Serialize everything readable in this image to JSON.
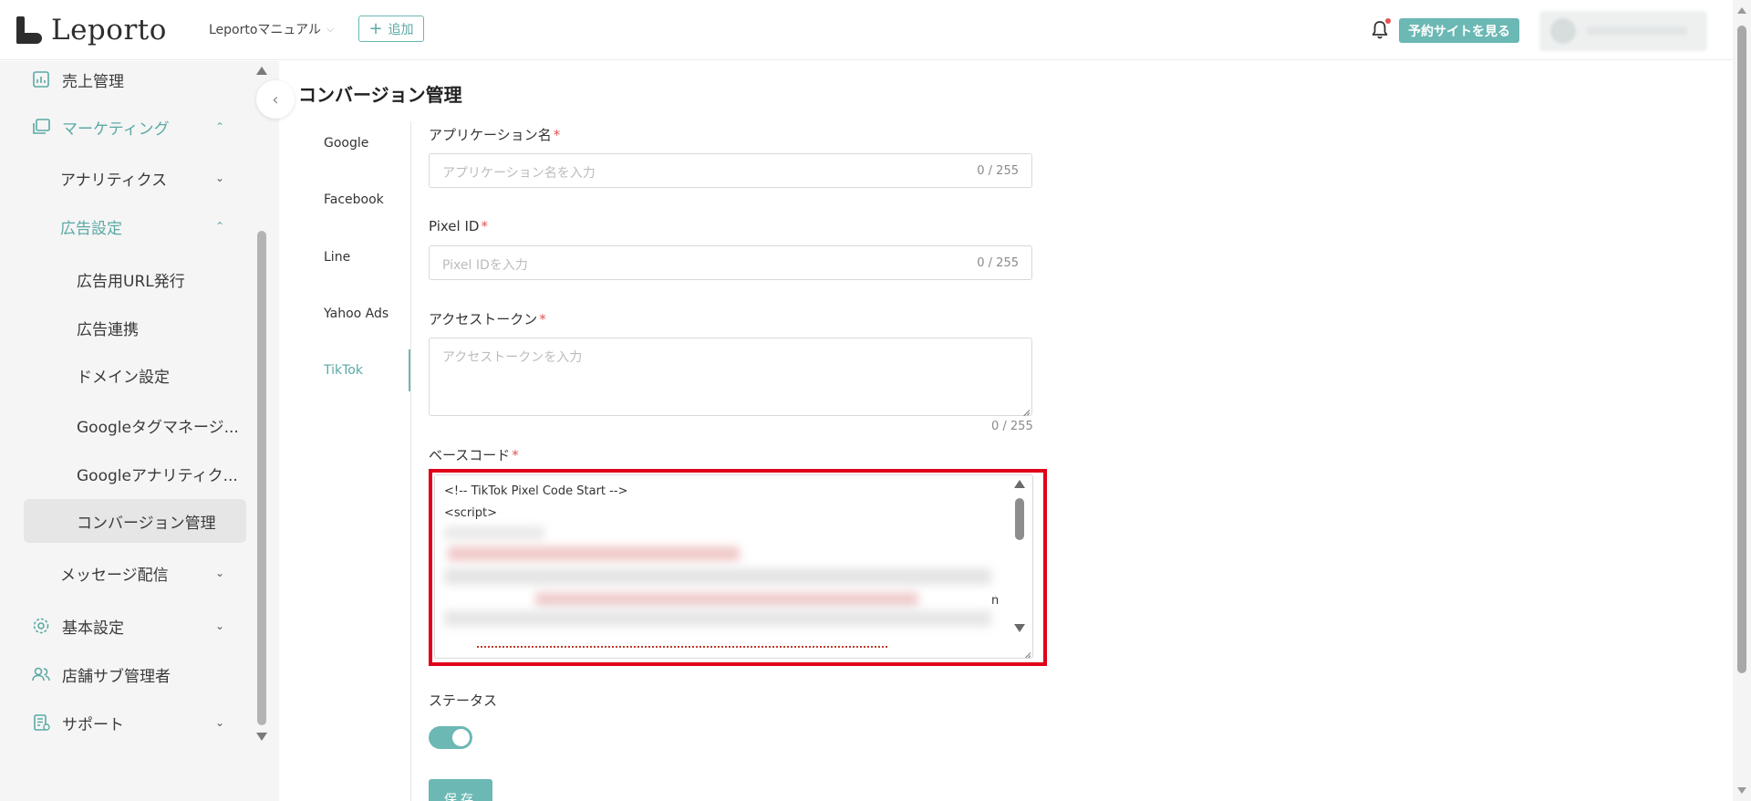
{
  "header": {
    "logo_text": "Leporto",
    "site_select": "Leportoマニュアル",
    "add_label": "追加",
    "view_site_label": "予約サイトを見る"
  },
  "sidebar": {
    "items": [
      {
        "label": "売上管理"
      },
      {
        "label": "マーケティング"
      },
      {
        "label": "アナリティクス"
      },
      {
        "label": "広告設定"
      },
      {
        "label": "広告用URL発行"
      },
      {
        "label": "広告連携"
      },
      {
        "label": "ドメイン設定"
      },
      {
        "label": "Googleタグマネージ..."
      },
      {
        "label": "Googleアナリティク..."
      },
      {
        "label": "コンバージョン管理"
      },
      {
        "label": "メッセージ配信"
      },
      {
        "label": "基本設定"
      },
      {
        "label": "店舗サブ管理者"
      },
      {
        "label": "サポート"
      }
    ]
  },
  "page": {
    "title": "コンバージョン管理"
  },
  "tabs": [
    {
      "label": "Google"
    },
    {
      "label": "Facebook"
    },
    {
      "label": "Line"
    },
    {
      "label": "Yahoo Ads"
    },
    {
      "label": "TikTok"
    }
  ],
  "form": {
    "app_name": {
      "label": "アプリケーション名",
      "placeholder": "アプリケーション名を入力",
      "count": "0 / 255"
    },
    "pixel_id": {
      "label": "Pixel ID",
      "placeholder": "Pixel IDを入力",
      "count": "0 / 255"
    },
    "access_token": {
      "label": "アクセストークン",
      "placeholder": "アクセストークンを入力",
      "count": "0 / 255"
    },
    "base_code": {
      "label": "ベースコード",
      "line1": "<!-- TikTok Pixel Code Start -->",
      "line2": "<script>",
      "trailing_char": "n"
    },
    "status": {
      "label": "ステータス",
      "enabled": true
    },
    "save_label": "保存"
  },
  "colors": {
    "accent": "#6bb8b4",
    "highlight": "#e0001a",
    "required": "#e55353"
  }
}
